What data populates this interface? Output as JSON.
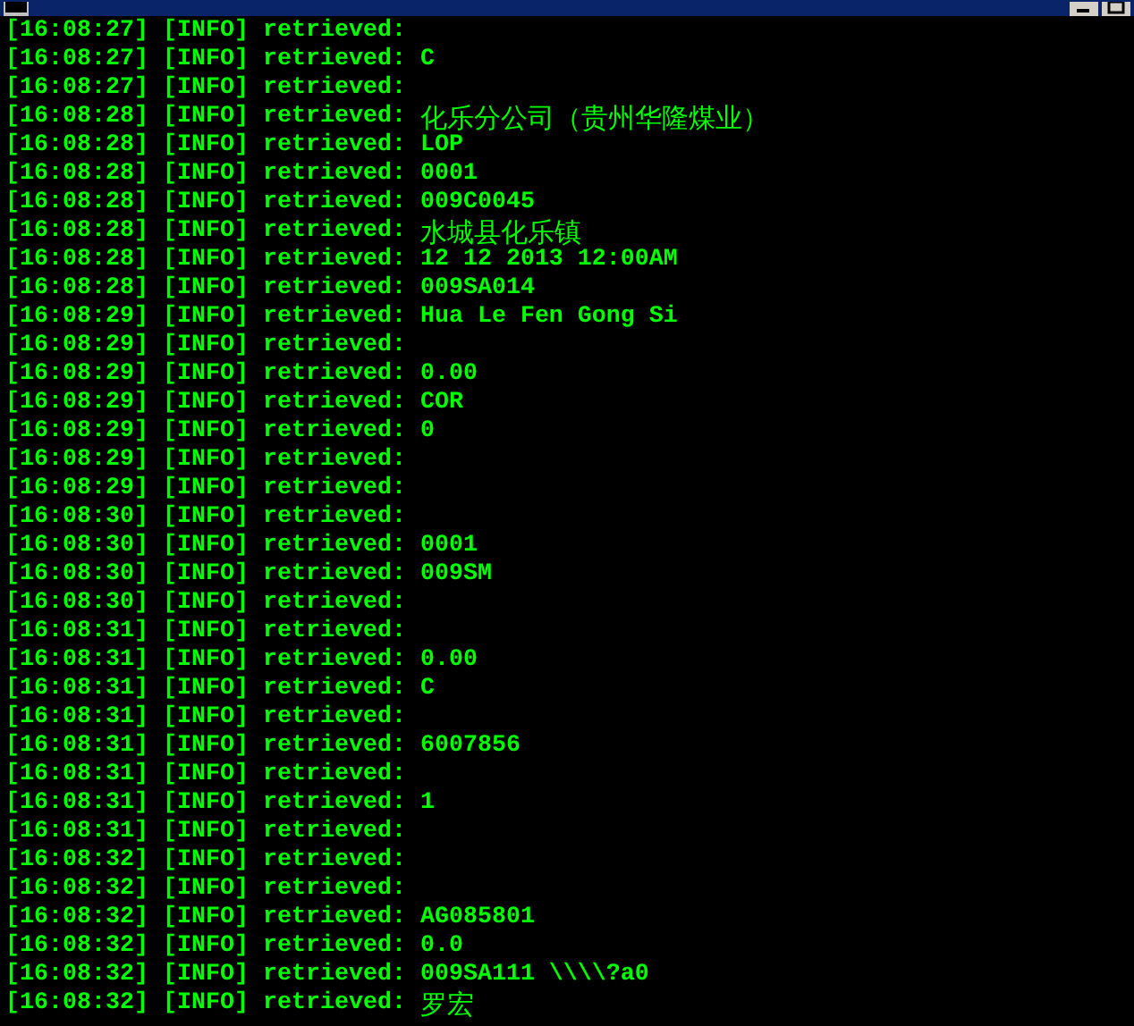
{
  "lines": [
    {
      "prefix": "[16:08:27] [INFO] retrieved:"
    },
    {
      "prefix": "[16:08:27] [INFO] retrieved:",
      "value": "C"
    },
    {
      "prefix": "[16:08:27] [INFO] retrieved:"
    },
    {
      "prefix": "[16:08:28] [INFO] retrieved:",
      "value": "化乐分公司（贵州华隆煤业）"
    },
    {
      "prefix": "[16:08:28] [INFO] retrieved:",
      "value": "LOP"
    },
    {
      "prefix": "[16:08:28] [INFO] retrieved:",
      "value": "0001"
    },
    {
      "prefix": "[16:08:28] [INFO] retrieved:",
      "value": "009C0045"
    },
    {
      "prefix": "[16:08:28] [INFO] retrieved:",
      "value": "水城县化乐镇"
    },
    {
      "prefix": "[16:08:28] [INFO] retrieved:",
      "value": "12 12 2013 12:00AM"
    },
    {
      "prefix": "[16:08:28] [INFO] retrieved:",
      "value": "009SA014"
    },
    {
      "prefix": "[16:08:29] [INFO] retrieved:",
      "value": "Hua Le Fen Gong Si"
    },
    {
      "prefix": "[16:08:29] [INFO] retrieved:"
    },
    {
      "prefix": "[16:08:29] [INFO] retrieved:",
      "value": "0.00"
    },
    {
      "prefix": "[16:08:29] [INFO] retrieved:",
      "value": "COR"
    },
    {
      "prefix": "[16:08:29] [INFO] retrieved:",
      "value": "0"
    },
    {
      "prefix": "[16:08:29] [INFO] retrieved:"
    },
    {
      "prefix": "[16:08:29] [INFO] retrieved:"
    },
    {
      "prefix": "[16:08:30] [INFO] retrieved:"
    },
    {
      "prefix": "[16:08:30] [INFO] retrieved:",
      "value": "0001"
    },
    {
      "prefix": "[16:08:30] [INFO] retrieved:",
      "value": "009SM"
    },
    {
      "prefix": "[16:08:30] [INFO] retrieved:"
    },
    {
      "prefix": "[16:08:31] [INFO] retrieved:"
    },
    {
      "prefix": "[16:08:31] [INFO] retrieved:",
      "value": "0.00"
    },
    {
      "prefix": "[16:08:31] [INFO] retrieved:",
      "value": "C"
    },
    {
      "prefix": "[16:08:31] [INFO] retrieved:"
    },
    {
      "prefix": "[16:08:31] [INFO] retrieved:",
      "value": "6007856"
    },
    {
      "prefix": "[16:08:31] [INFO] retrieved:"
    },
    {
      "prefix": "[16:08:31] [INFO] retrieved:",
      "value": "1"
    },
    {
      "prefix": "[16:08:31] [INFO] retrieved:"
    },
    {
      "prefix": "[16:08:32] [INFO] retrieved:"
    },
    {
      "prefix": "[16:08:32] [INFO] retrieved:"
    },
    {
      "prefix": "[16:08:32] [INFO] retrieved:",
      "value": "AG085801"
    },
    {
      "prefix": "[16:08:32] [INFO] retrieved:",
      "value": "0.0"
    },
    {
      "prefix": "[16:08:32] [INFO] retrieved:",
      "value": "009SA111 \\\\\\\\?a0"
    },
    {
      "prefix": "[16:08:32] [INFO] retrieved:",
      "value": "罗宏"
    }
  ]
}
